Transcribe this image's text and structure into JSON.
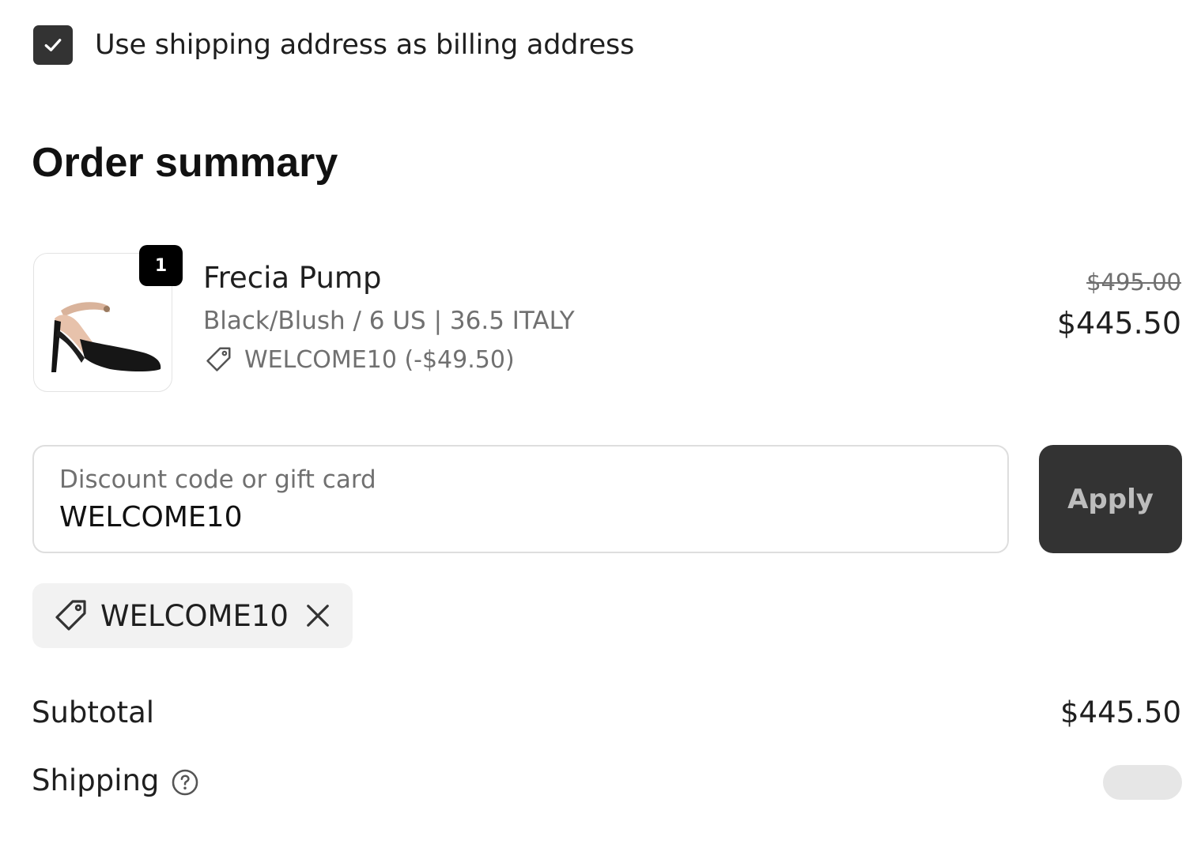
{
  "billing": {
    "checked": true,
    "label": "Use shipping address as billing address"
  },
  "summary": {
    "title": "Order summary"
  },
  "line_item": {
    "quantity": "1",
    "name": "Frecia Pump",
    "variant": "Black/Blush / 6 US | 36.5 ITALY",
    "discount": "WELCOME10 (-$49.50)",
    "original_price": "$495.00",
    "price": "$445.50",
    "image": "shoe-image"
  },
  "discount_form": {
    "label": "Discount code or gift card",
    "value": "WELCOME10",
    "apply_label": "Apply"
  },
  "applied_discount": {
    "code": "WELCOME10"
  },
  "totals": {
    "subtotal_label": "Subtotal",
    "subtotal_value": "$445.50",
    "shipping_label": "Shipping"
  },
  "colors": {
    "checkbox": "#333333",
    "apply_button": "#333333",
    "muted_text": "#707070",
    "chip_bg": "#f2f2f2"
  },
  "icons": {
    "checkbox": "checkmark-icon",
    "discount": "tag-icon",
    "remove": "close-icon",
    "shipping_help": "question-circle-icon"
  }
}
